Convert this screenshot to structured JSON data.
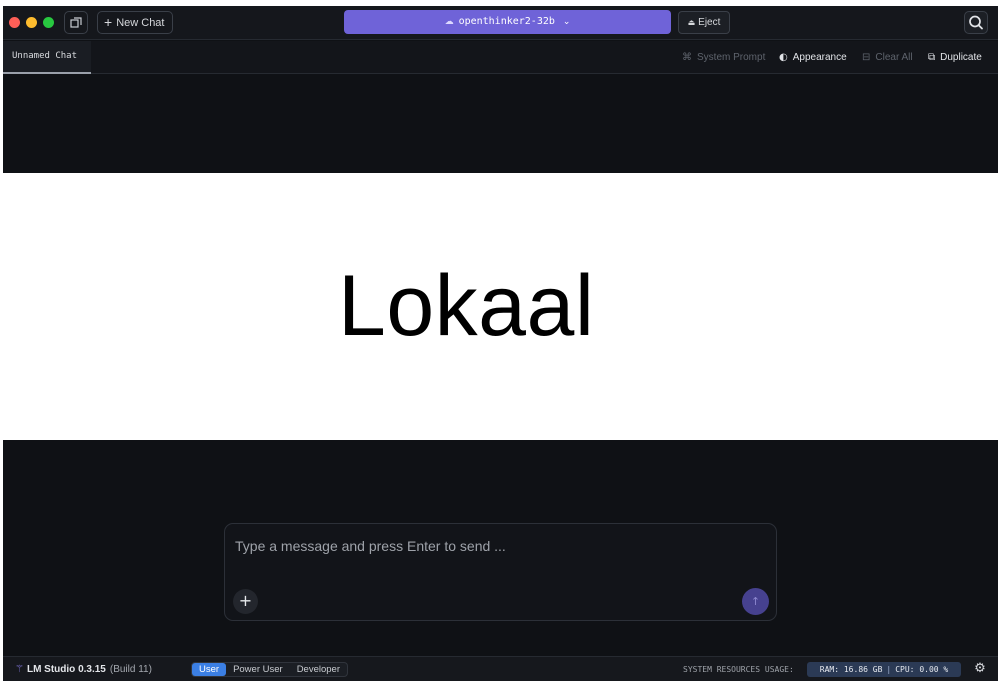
{
  "window": {
    "new_chat_label": "New Chat",
    "model_name": "openthinker2-32b",
    "eject_label": "Eject"
  },
  "tabs": {
    "active": "Unnamed Chat"
  },
  "toolbar": {
    "system_prompt": "System Prompt",
    "appearance": "Appearance",
    "clear_all": "Clear All",
    "duplicate": "Duplicate"
  },
  "banner": {
    "title": "Lokaal"
  },
  "composer": {
    "placeholder": "Type a message and press Enter to send ...",
    "value": ""
  },
  "statusbar": {
    "app_version": "LM Studio 0.3.15",
    "build": "(Build 11)",
    "modes": [
      "User",
      "Power User",
      "Developer"
    ],
    "active_mode": "User",
    "resources_label": "SYSTEM RESOURCES USAGE:",
    "ram": "RAM: 16.86 GB",
    "cpu": "CPU: 0.00 %"
  },
  "colors": {
    "accent": "#6f63d8",
    "background": "#0f1115",
    "active_mode": "#3b7fe4"
  },
  "icons": {
    "traffic_lights": [
      "close-dot",
      "minimize-dot",
      "zoom-dot"
    ],
    "sidebar_toggle": "sidebar-toggle-icon",
    "model": "cloud-icon",
    "search": "search-icon",
    "settings": "gear-icon"
  }
}
